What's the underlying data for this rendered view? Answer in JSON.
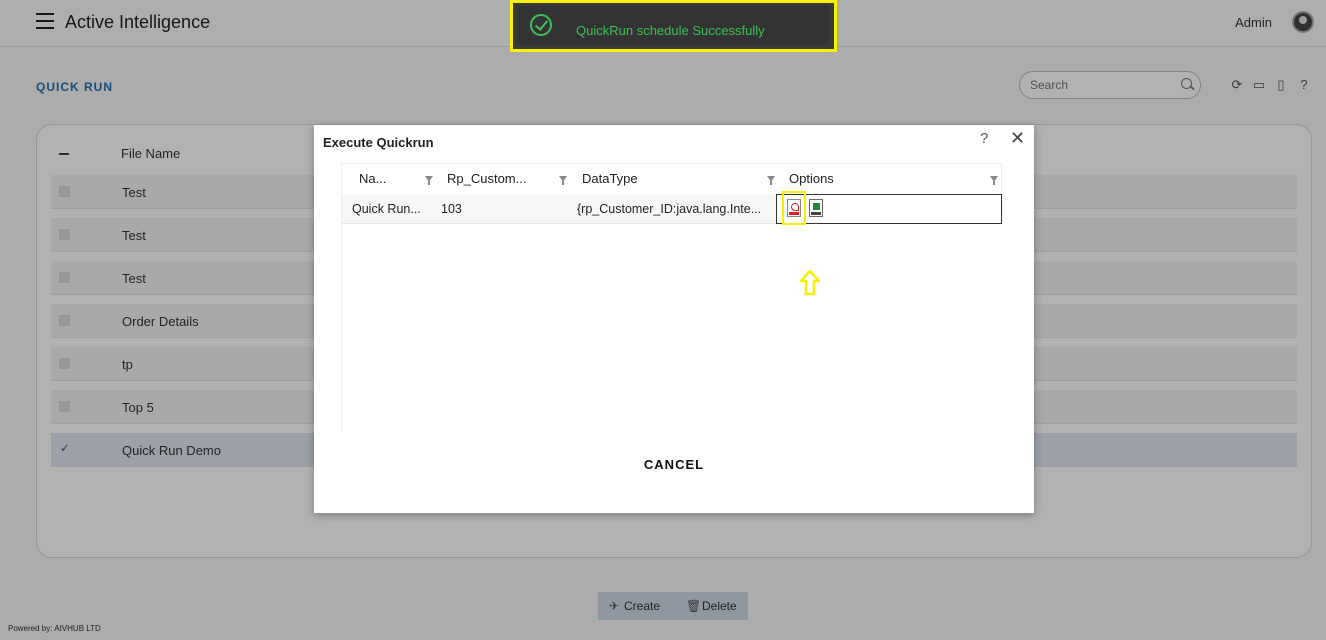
{
  "header": {
    "app_title": "Active Intelligence",
    "user_name": "Admin"
  },
  "page": {
    "title": "QUICK RUN",
    "search_placeholder": "Search"
  },
  "list": {
    "column_file_name": "File Name",
    "rows": [
      {
        "name": "Test",
        "selected": false
      },
      {
        "name": "Test",
        "selected": false
      },
      {
        "name": "Test",
        "selected": false
      },
      {
        "name": "Order Details",
        "selected": false
      },
      {
        "name": "tp",
        "selected": false
      },
      {
        "name": "Top 5",
        "selected": false
      },
      {
        "name": "Quick Run Demo",
        "selected": true
      }
    ]
  },
  "bottom": {
    "create_label": "Create",
    "delete_label": "Delete",
    "powered_by": "Powered by: AIVHUB LTD"
  },
  "toast": {
    "message": "QuickRun schedule Successfully",
    "color": "#3ac154",
    "highlight_color": "#f6f200"
  },
  "modal": {
    "title": "Execute Quickrun",
    "help_glyph": "?",
    "close_glyph": "✕",
    "columns": [
      "Na...",
      "Rp_Custom...",
      "DataType",
      "Options"
    ],
    "row": {
      "name": "Quick Run...",
      "rp_customer": "103",
      "datatype": "{rp_Customer_ID:java.lang.Inte..."
    },
    "cancel_label": "CANCEL"
  }
}
